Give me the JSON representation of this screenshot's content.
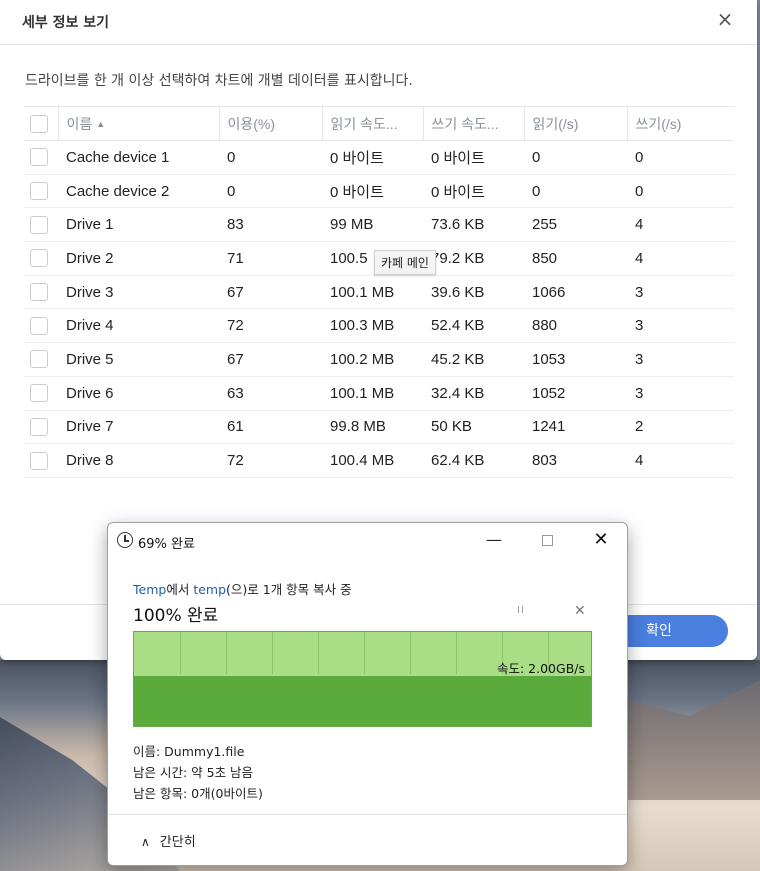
{
  "details_dialog": {
    "title": "세부 정보 보기",
    "close_icon": "×",
    "description": "드라이브를 한 개 이상 선택하여 차트에 개별 데이터를 표시합니다.",
    "columns": [
      "이름",
      "이용(%)",
      "읽기 속도...",
      "쓰기 속도...",
      "읽기(/s)",
      "쓰기(/s)"
    ],
    "sort_indicator": "▲",
    "rows": [
      {
        "name": "Cache device 1",
        "usage": "0",
        "read_speed": "0 바이트",
        "write_speed": "0 바이트",
        "reads": "0",
        "writes": "0"
      },
      {
        "name": "Cache device 2",
        "usage": "0",
        "read_speed": "0 바이트",
        "write_speed": "0 바이트",
        "reads": "0",
        "writes": "0"
      },
      {
        "name": "Drive 1",
        "usage": "83",
        "read_speed": "99 MB",
        "write_speed": "73.6 KB",
        "reads": "255",
        "writes": "4"
      },
      {
        "name": "Drive 2",
        "usage": "71",
        "read_speed": "100.5",
        "write_speed": "79.2 KB",
        "reads": "850",
        "writes": "4"
      },
      {
        "name": "Drive 3",
        "usage": "67",
        "read_speed": "100.1 MB",
        "write_speed": "39.6 KB",
        "reads": "1066",
        "writes": "3"
      },
      {
        "name": "Drive 4",
        "usage": "72",
        "read_speed": "100.3 MB",
        "write_speed": "52.4 KB",
        "reads": "880",
        "writes": "3"
      },
      {
        "name": "Drive 5",
        "usage": "67",
        "read_speed": "100.2 MB",
        "write_speed": "45.2 KB",
        "reads": "1053",
        "writes": "3"
      },
      {
        "name": "Drive 6",
        "usage": "63",
        "read_speed": "100.1 MB",
        "write_speed": "32.4 KB",
        "reads": "1052",
        "writes": "3"
      },
      {
        "name": "Drive 7",
        "usage": "61",
        "read_speed": "99.8 MB",
        "write_speed": "50 KB",
        "reads": "1241",
        "writes": "2"
      },
      {
        "name": "Drive 8",
        "usage": "72",
        "read_speed": "100.4 MB",
        "write_speed": "62.4 KB",
        "reads": "803",
        "writes": "4"
      }
    ],
    "tooltip": "카페 메인",
    "ok_button": "확인",
    "accent_color": "#4a7fe0"
  },
  "copy_window": {
    "title": "69% 완료",
    "minimize_icon": "—",
    "close_icon": "✕",
    "source_link": "Temp",
    "desc_mid": "에서 ",
    "dest_link": "temp",
    "desc_end": "(으)로 1개 항목 복사 중",
    "percent_label": "100% 완료",
    "pause_icon": "II",
    "cancel_icon": "✕",
    "speed_label": "속도: 2.00GB/s",
    "file_name": "이름: Dummy1.file",
    "time_left": "남은 시간: 약 5초 남음",
    "items_left": "남은 항목: 0개(0바이트)",
    "toggle_label": "간단히",
    "toggle_icon": "∧",
    "progress_fraction": 1.0,
    "graph_color": "#5aab3b"
  }
}
